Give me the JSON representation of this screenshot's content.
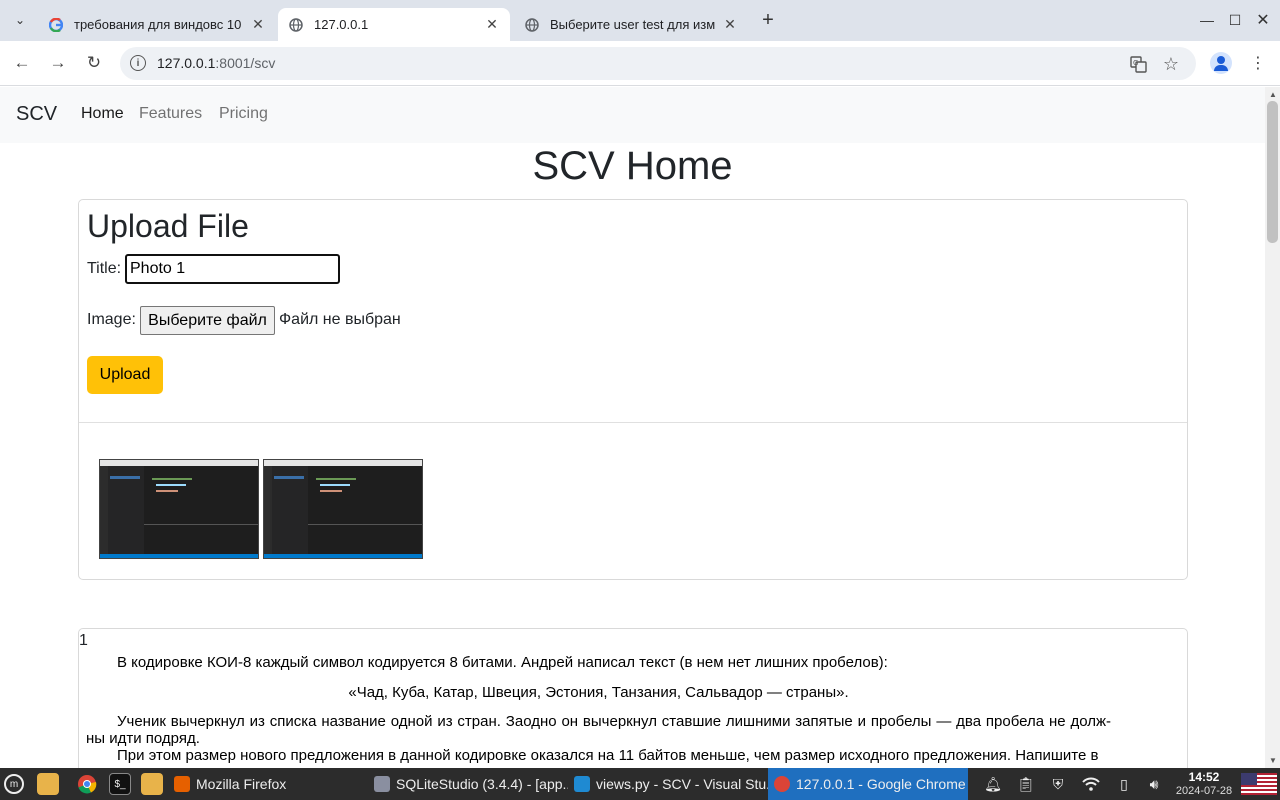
{
  "browser": {
    "tabs": [
      {
        "title": "требования для виндовс 10",
        "favicon": "google-icon",
        "active": false
      },
      {
        "title": "127.0.0.1",
        "favicon": "globe-icon",
        "active": true
      },
      {
        "title": "Выберите user test для изм",
        "favicon": "globe-icon",
        "active": false
      }
    ],
    "url_host": "127.0.0.1",
    "url_rest": ":8001/scv"
  },
  "site": {
    "brand": "SCV",
    "nav": [
      "Home",
      "Features",
      "Pricing"
    ],
    "page_title": "SCV Home"
  },
  "upload": {
    "heading": "Upload File",
    "title_label": "Title:",
    "title_value": "Photo 1",
    "image_label": "Image:",
    "file_button": "Выберите файл",
    "file_status": "Файл не выбран",
    "submit": "Upload"
  },
  "task": {
    "number": "1",
    "para1": "В кодировке КОИ-8 каждый символ кодируется 8 битами. Андрей написал текст (в нем нет лишних пробелов):",
    "para2": "«Чад, Куба, Катар, Швеция, Эстония, Танзания, Сальвадор — страны».",
    "para3": "Ученик вычеркнул из списка название одной из стран. Заодно он вычеркнул ставшие лишними запятые и пробелы — два пробела не долж-ны идти подряд.",
    "para4": "При этом размер нового предложения в данной кодировке оказался на 11 байтов меньше, чем размер исходного предложения. Напишите в"
  },
  "taskbar": {
    "tasks": [
      "Mozilla Firefox",
      "SQLiteStudio (3.4.4) - [app...",
      "views.py - SCV - Visual Stu...",
      "127.0.0.1 - Google Chrome"
    ],
    "time": "14:52",
    "date": "2024-07-28"
  },
  "colors": {
    "upload_button": "#ffc107",
    "active_task": "#1f6fbf"
  }
}
